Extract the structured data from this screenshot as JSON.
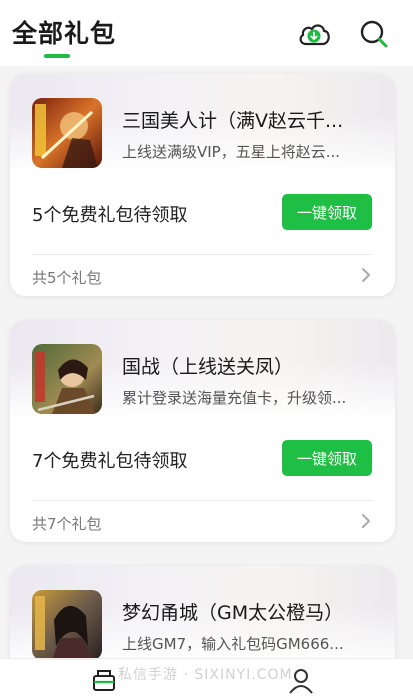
{
  "header": {
    "title": "全部礼包",
    "download_icon": "cloud-download-icon",
    "search_icon": "search-icon",
    "accent_color": "#1fb944"
  },
  "gifts": [
    {
      "name": "三国美人计（满V赵云千...",
      "description": "上线送满级VIP，五星上将赵云...",
      "free_count_text": "5个免费礼包待领取",
      "claim_label": "一键领取",
      "total_text": "共5个礼包"
    },
    {
      "name": "国战（上线送关凤）",
      "description": "累计登录送海量充值卡，升级领...",
      "free_count_text": "7个免费礼包待领取",
      "claim_label": "一键领取",
      "total_text": "共7个礼包"
    },
    {
      "name": "梦幻甬城（GM太公橙马）",
      "description": "上线GM7，输入礼包码GM666...",
      "free_count_text": "",
      "claim_label": "",
      "total_text": ""
    }
  ],
  "bottom_nav": {
    "items": [
      {
        "icon": "gift-box-icon"
      },
      {
        "icon": "user-icon"
      }
    ]
  },
  "watermark": "私信手游 · SIXINYI.COM",
  "colors": {
    "claim_button": "#1fbf45",
    "background": "#f4f4f4"
  }
}
